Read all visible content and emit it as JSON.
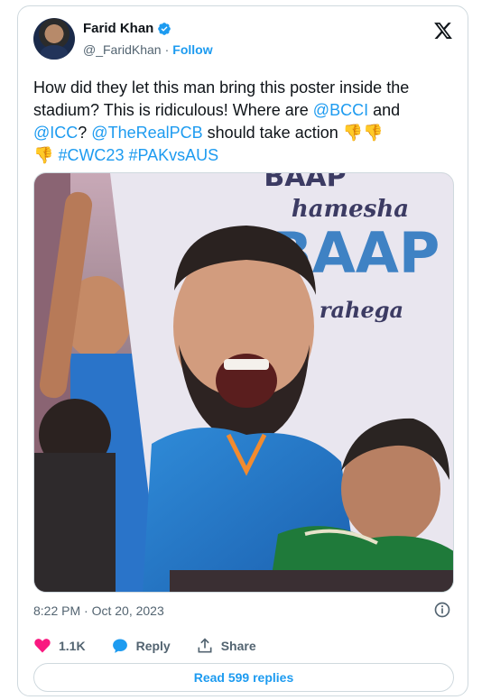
{
  "author": {
    "name": "Farid Khan",
    "handle": "@_FaridKhan",
    "separator": "·",
    "follow_label": "Follow"
  },
  "tweet": {
    "text_1": "How did they let this man bring this poster inside the stadium? This is ridiculous! Where are ",
    "mention_bcci": "@BCCI",
    "text_2": " and ",
    "mention_icc": "@ICC",
    "text_3": "? ",
    "mention_pcb": "@TheRealPCB",
    "text_4": " should take action ",
    "emoji_1": "👎👎",
    "emoji_2": "👎",
    "hashtag_1": "#CWC23",
    "hashtag_2": "#PAKvsAUS",
    "timestamp": "8:22 PM · Oct 20, 2023"
  },
  "poster": {
    "line_top": "BAAP",
    "line_1": "hamesha",
    "line_2": "BAAP",
    "line_3": "hi rahega"
  },
  "actions": {
    "likes": "1.1K",
    "reply_label": "Reply",
    "share_label": "Share"
  },
  "replies_button": "Read 599 replies",
  "colors": {
    "accent": "#1d9bf0",
    "like": "#f91880",
    "text": "#0f1419",
    "muted": "#536471"
  }
}
